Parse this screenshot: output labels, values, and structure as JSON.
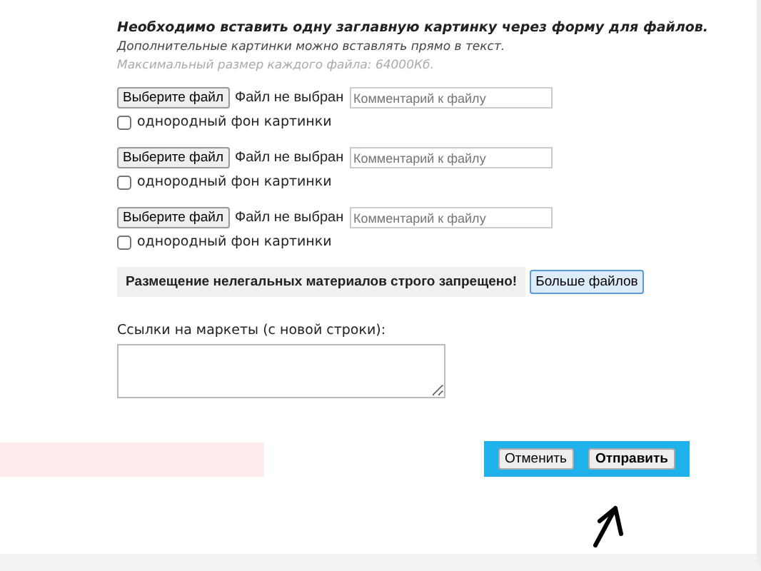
{
  "notice": {
    "title": "Необходимо вставить одну заглавную картинку через форму для файлов.",
    "hint": "Дополнительные картинки можно вставлять прямо в текст.",
    "limit": "Максимальный размер каждого файла: 64000Кб."
  },
  "files": [
    {
      "button": "Выберите файл",
      "status": "Файл не выбран",
      "placeholder": "Комментарий к файлу",
      "option": "однородный фон картинки",
      "checked": false
    },
    {
      "button": "Выберите файл",
      "status": "Файл не выбран",
      "placeholder": "Комментарий к файлу",
      "option": "однородный фон картинки",
      "checked": false
    },
    {
      "button": "Выберите файл",
      "status": "Файл не выбран",
      "placeholder": "Комментарий к файлу",
      "option": "однородный фон картинки",
      "checked": false
    }
  ],
  "warning": "Размещение нелегальных материалов строго запрещено!",
  "more_button": "Больше файлов",
  "links": {
    "label": "Ссылки на маркеты (с новой строки):"
  },
  "actions": [
    "Отменить",
    "Отправить"
  ]
}
